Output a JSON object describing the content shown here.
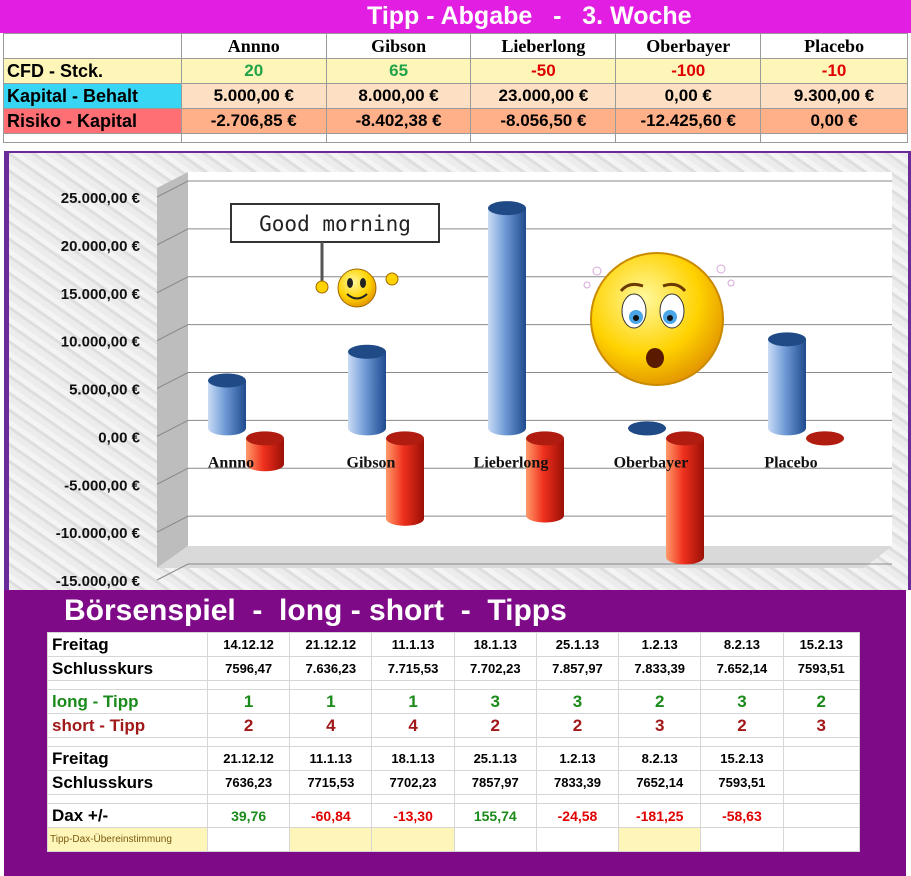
{
  "title": "Tipp - Abgabe   -   3. Woche",
  "players": [
    "Annno",
    "Gibson",
    "Lieberlong",
    "Oberbayer",
    "Placebo"
  ],
  "rows": {
    "cfd": {
      "label": "CFD - Stck.",
      "values": [
        "20",
        "65",
        "-50",
        "-100",
        "-10"
      ]
    },
    "kapital": {
      "label": "Kapital - Behalt",
      "values": [
        "5.000,00 €",
        "8.000,00 €",
        "23.000,00 €",
        "0,00 €",
        "9.300,00 €"
      ]
    },
    "risiko": {
      "label": "Risiko - Kapital",
      "values": [
        "-2.706,85 €",
        "-8.402,38 €",
        "-8.056,50 €",
        "-12.425,60 €",
        "0,00 €"
      ]
    }
  },
  "colors": {
    "title_bg": "#e11ee1",
    "positive": "#22a34a",
    "negative": "#e00000",
    "panel": "#7e0a88"
  },
  "chart_data": {
    "type": "bar",
    "categories": [
      "Annno",
      "Gibson",
      "Lieberlong",
      "Oberbayer",
      "Placebo"
    ],
    "series": [
      {
        "values": [
          5000,
          8000,
          23000,
          0,
          9300
        ],
        "color": "#3a6fb8"
      },
      {
        "values": [
          -2706.85,
          -8402.38,
          -8056.5,
          -12425.6,
          0
        ],
        "color": "#e3261b"
      }
    ],
    "ylim": [
      -15000,
      25000
    ],
    "yticks": [
      "25.000,00 €",
      "20.000,00 €",
      "15.000,00 €",
      "10.000,00 €",
      "5.000,00 €",
      "0,00 €",
      "-5.000,00 €",
      "-10.000,00 €",
      "-15.000,00 €"
    ],
    "ytick_values": [
      25000,
      20000,
      15000,
      10000,
      5000,
      0,
      -5000,
      -10000,
      -15000
    ],
    "grid": true,
    "callout": "Good morning"
  },
  "bottom": {
    "title": "Börsenspiel  -  long - short  -  Tipps",
    "freitag_label": "Freitag",
    "schluss_label": "Schlusskurs",
    "dates1": [
      "14.12.12",
      "21.12.12",
      "11.1.13",
      "18.1.13",
      "25.1.13",
      "1.2.13",
      "8.2.13",
      "15.2.13"
    ],
    "kurs1": [
      "7596,47",
      "7.636,23",
      "7.715,53",
      "7.702,23",
      "7.857,97",
      "7.833,39",
      "7.652,14",
      "7593,51"
    ],
    "long_label": "long - Tipp",
    "long": [
      "1",
      "1",
      "1",
      "3",
      "3",
      "2",
      "3",
      "2"
    ],
    "short_label": "short - Tipp",
    "short": [
      "2",
      "4",
      "4",
      "2",
      "2",
      "3",
      "2",
      "3"
    ],
    "dates2": [
      "21.12.12",
      "11.1.13",
      "18.1.13",
      "25.1.13",
      "1.2.13",
      "8.2.13",
      "15.2.13",
      ""
    ],
    "kurs2": [
      "7636,23",
      "7715,53",
      "7702,23",
      "7857,97",
      "7833,39",
      "7652,14",
      "7593,51",
      ""
    ],
    "dax_label": "Dax +/-",
    "dax": [
      "39,76",
      "-60,84",
      "-13,30",
      "155,74",
      "-24,58",
      "-181,25",
      "-58,63",
      ""
    ],
    "note": "Tipp-Dax-Übereinstimmung"
  }
}
